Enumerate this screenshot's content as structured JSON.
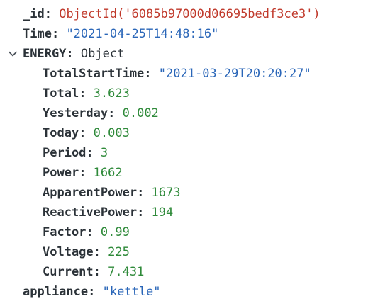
{
  "document": {
    "id_field": {
      "key": "_id",
      "value": "ObjectId('6085b97000d06695bedf3ce3')"
    },
    "time_field": {
      "key": "Time",
      "value": "\"2021-04-25T14:48:16\""
    },
    "energy": {
      "key": "ENERGY",
      "type": "Object",
      "expanded": true,
      "fields": [
        {
          "key": "TotalStartTime",
          "value": "\"2021-03-29T20:20:27\"",
          "kind": "string"
        },
        {
          "key": "Total",
          "value": "3.623",
          "kind": "number"
        },
        {
          "key": "Yesterday",
          "value": "0.002",
          "kind": "number"
        },
        {
          "key": "Today",
          "value": "0.003",
          "kind": "number"
        },
        {
          "key": "Period",
          "value": "3",
          "kind": "number"
        },
        {
          "key": "Power",
          "value": "1662",
          "kind": "number"
        },
        {
          "key": "ApparentPower",
          "value": "1673",
          "kind": "number"
        },
        {
          "key": "ReactivePower",
          "value": "194",
          "kind": "number"
        },
        {
          "key": "Factor",
          "value": "0.99",
          "kind": "number"
        },
        {
          "key": "Voltage",
          "value": "225",
          "kind": "number"
        },
        {
          "key": "Current",
          "value": "7.431",
          "kind": "number"
        }
      ]
    },
    "appliance_field": {
      "key": "appliance",
      "value": "\"kettle\""
    }
  },
  "icons": {
    "expand_toggle": "chevron-down-icon"
  },
  "colors": {
    "key": "#2b3238",
    "string": "#2a66b8",
    "number": "#2f8a3a",
    "objectid": "#c0392b"
  }
}
